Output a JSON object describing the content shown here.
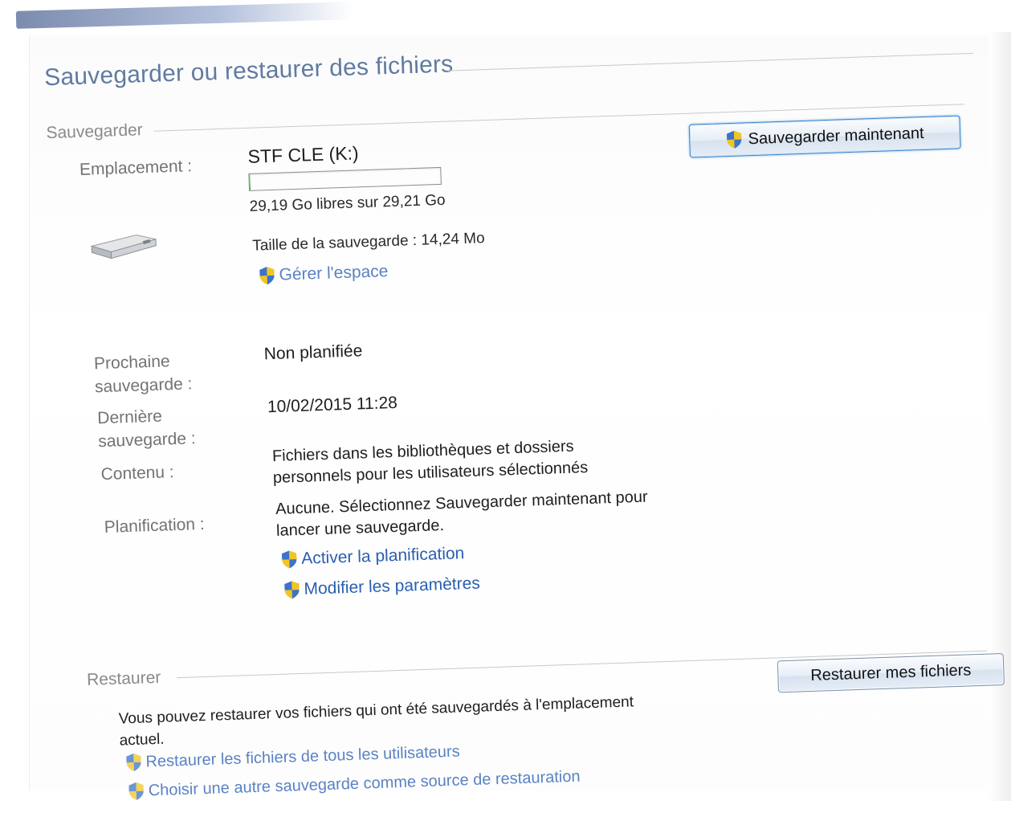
{
  "window": {
    "title": "Sauvegarder ou restaurer des fichiers"
  },
  "backup": {
    "section_label": "Sauvegarder",
    "backup_now_label": "Sauvegarder maintenant",
    "location": {
      "label": "Emplacement :",
      "drive_name": "STF CLE (K:)",
      "used_fraction": 0.0007,
      "free_space": "29,19 Go libres sur 29,21 Go",
      "backup_size": "Taille de la sauvegarde : 14,24 Mo",
      "manage_space_link": "Gérer l'espace",
      "drive_icon": "usb-drive-icon"
    },
    "next_backup": {
      "label_line1": "Prochaine",
      "label_line2": "sauvegarde :",
      "value": "Non planifiée"
    },
    "last_backup": {
      "label_line1": "Dernière",
      "label_line2": "sauvegarde :",
      "value": "10/02/2015 11:28"
    },
    "contents": {
      "label": "Contenu :",
      "line1": "Fichiers dans les bibliothèques et dossiers",
      "line2": "personnels pour les utilisateurs sélectionnés"
    },
    "schedule": {
      "label": "Planification :",
      "line1": "Aucune. Sélectionnez Sauvegarder maintenant pour",
      "line2": "lancer une sauvegarde.",
      "enable_link": "Activer la planification",
      "settings_link": "Modifier les paramètres"
    }
  },
  "restore": {
    "section_label": "Restaurer",
    "restore_button_label": "Restaurer mes fichiers",
    "description_line1": "Vous pouvez restaurer vos fichiers qui ont été sauvegardés à l'emplacement",
    "description_line2": "actuel.",
    "all_users_link": "Restaurer les fichiers de tous les utilisateurs",
    "other_backup_link": "Choisir une autre sauvegarde comme source de restauration"
  },
  "colors": {
    "title": "#3a5a8c",
    "link": "#2a5fb0",
    "shield_blue": "#3b74c9",
    "shield_yellow": "#f2c522"
  },
  "icons": {
    "uac_shield": "uac-shield-icon",
    "drive": "usb-drive-icon"
  }
}
